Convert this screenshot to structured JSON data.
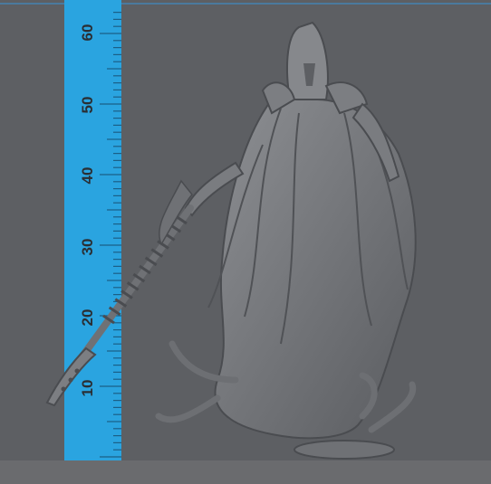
{
  "ruler": {
    "color": "#2aa4e0",
    "labels": [
      "60",
      "50",
      "40",
      "30",
      "20",
      "10"
    ]
  },
  "colors": {
    "background": "#5d5f63",
    "model": "#7a7c80",
    "model_shadow": "#4f5155",
    "floor": "#6a6b6e"
  }
}
